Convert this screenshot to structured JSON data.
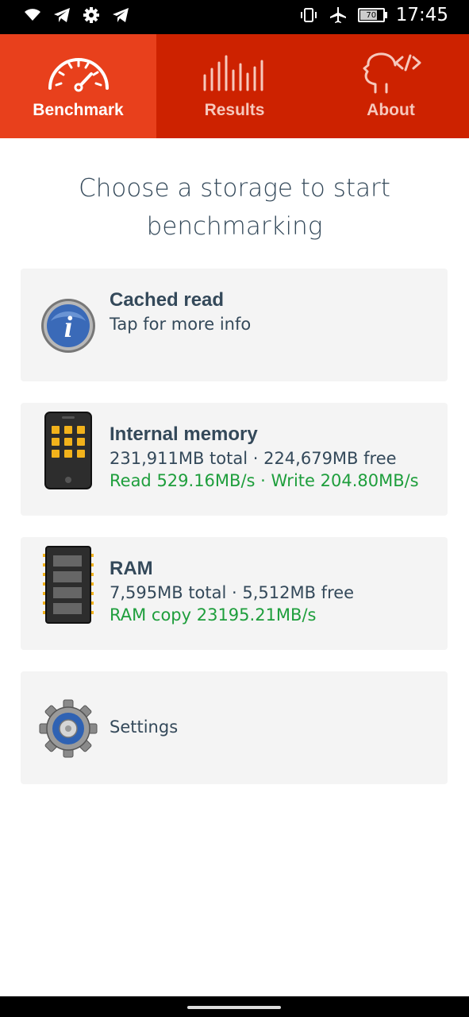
{
  "status_bar": {
    "time": "17:45",
    "battery_level": "70",
    "icons_left": [
      "wifi-icon",
      "telegram-icon",
      "gear-icon",
      "telegram-icon"
    ],
    "icons_right": [
      "vibrate-icon",
      "airplane-icon",
      "battery-icon"
    ]
  },
  "tabs": [
    {
      "label": "Benchmark",
      "icon": "speedometer-icon",
      "active": true
    },
    {
      "label": "Results",
      "icon": "bars-icon",
      "active": false
    },
    {
      "label": "About",
      "icon": "head-code-icon",
      "active": false
    }
  ],
  "heading": {
    "line1": "Choose a storage to start",
    "line2": "benchmarking"
  },
  "cards": {
    "cached": {
      "title": "Cached read",
      "subtitle": "Tap for more info",
      "icon": "info-icon"
    },
    "internal": {
      "title": "Internal memory",
      "line1": "231,911MB total · 224,679MB free",
      "line2": "Read 529.16MB/s · Write 204.80MB/s",
      "icon": "phone-icon"
    },
    "ram": {
      "title": "RAM",
      "line1": "7,595MB total · 5,512MB free",
      "line2": "RAM copy 23195.21MB/s",
      "icon": "ram-chip-icon"
    },
    "settings": {
      "label": "Settings",
      "icon": "settings-gear-icon"
    }
  },
  "colors": {
    "tab_bar": "#cd2200",
    "tab_active": "#e8401c",
    "result_green": "#1e9e3c",
    "text": "#34495a",
    "card_bg": "#f4f4f4"
  }
}
